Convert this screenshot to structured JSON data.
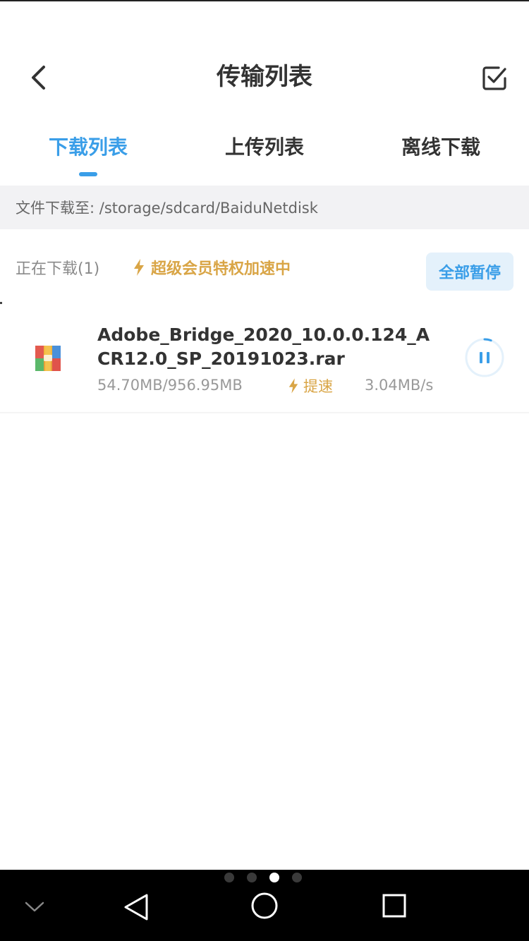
{
  "header": {
    "title": "传输列表",
    "back_icon": "chevron-left-icon",
    "select_icon": "checkbox-icon"
  },
  "tabs": [
    {
      "label": "下载列表",
      "active": true
    },
    {
      "label": "上传列表",
      "active": false
    },
    {
      "label": "离线下载",
      "active": false
    }
  ],
  "path_bar": {
    "text": "文件下载至: /storage/sdcard/BaiduNetdisk"
  },
  "section": {
    "title": "正在下载(1)",
    "vip_text": "超级会员特权加速中",
    "pause_all_label": "全部暂停"
  },
  "downloads": [
    {
      "filename": "Adobe_Bridge_2020_10.0.0.124_ACR12.0_SP_20191023.rar",
      "progress_text": "54.70MB/956.95MB",
      "progress_fraction": 0.057,
      "boost_label": "提速",
      "speed": "3.04MB/s",
      "icon": "rar-archive-icon"
    }
  ],
  "colors": {
    "accent": "#3a9ee8",
    "vip_gold": "#d9a546",
    "muted_text": "#999999",
    "path_bar_bg": "#f2f2f4"
  },
  "page_indicator": {
    "count": 4,
    "active_index": 2
  },
  "navbar": {
    "icons": [
      "chevron-down-icon",
      "back-triangle-icon",
      "home-circle-icon",
      "recent-square-icon"
    ]
  }
}
